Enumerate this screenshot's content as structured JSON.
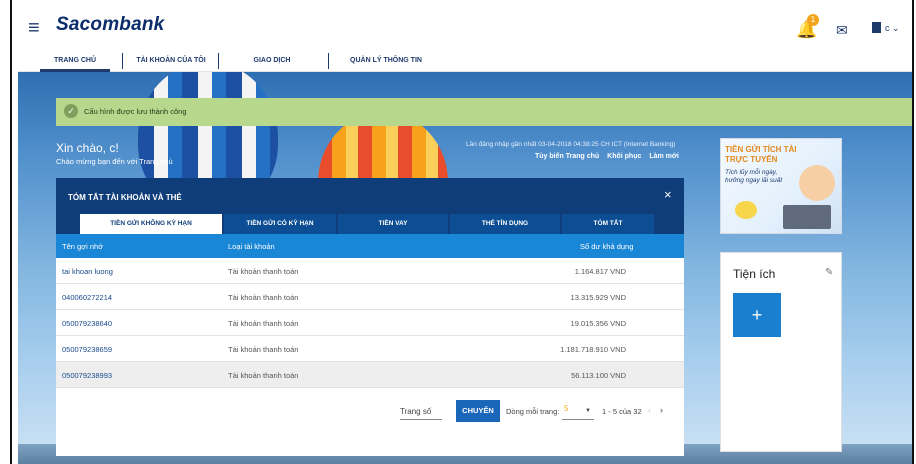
{
  "header": {
    "brand": "Sacombank",
    "notification_count": "1",
    "user_initial": "c"
  },
  "nav": {
    "tabs": [
      "TRANG CHỦ",
      "TÀI KHOẢN CỦA TÔI",
      "GIAO DỊCH",
      "QUẢN LÝ THÔNG TIN"
    ],
    "active": "TRANG CHỦ"
  },
  "banner": {
    "message": "Cấu hình được lưu thành công"
  },
  "greeting": {
    "title": "Xin chào, c!",
    "subtitle": "Chào mừng bạn đến với Trang chủ",
    "last_login": "Lần đăng nhập gần nhất 03-04-2018 04:38:25 CH ICT (Internet Banking)",
    "links": [
      "Tùy biến Trang chủ",
      "Khôi phục",
      "Làm mới"
    ]
  },
  "promo": {
    "title": "TIỀN GỬI TÍCH TÀI TRỰC TUYẾN",
    "subtitle": "Tích lũy mỗi ngày, hưởng ngay lãi suất"
  },
  "utility": {
    "title": "Tiện ích",
    "add_label": "+"
  },
  "summary": {
    "title": "TÓM TẮT TÀI KHOẢN VÀ THẺ",
    "close": "×",
    "tabs": [
      "TIỀN GỬI KHÔNG KỲ HẠN",
      "TIỀN GỬI CÓ KỲ HẠN",
      "TIỀN VAY",
      "THẺ TÍN DỤNG",
      "TÓM TẮT"
    ],
    "active_tab": 0,
    "columns": [
      "Tên gợi nhớ",
      "Loại tài khoản",
      "Số dư khả dụng"
    ],
    "rows": [
      {
        "name": "tai khoan luong",
        "type": "Tài khoản thanh toán",
        "balance": "1.164.817 VND"
      },
      {
        "name": "040060272214",
        "type": "Tài khoản thanh toán",
        "balance": "13.315.929 VND"
      },
      {
        "name": "050079238640",
        "type": "Tài khoản thanh toán",
        "balance": "19.015.356 VND"
      },
      {
        "name": "050079238659",
        "type": "Tài khoản thanh toán",
        "balance": "1.181.718.910 VND"
      },
      {
        "name": "050079238993",
        "type": "Tài khoản thanh toán",
        "balance": "56.113.100 VND"
      }
    ],
    "highlighted_row": 4
  },
  "pager": {
    "page_label": "Trang số",
    "go_button": "CHUYỂN",
    "rows_label": "Dòng mỗi trang:",
    "rows_value": "5",
    "range": "1 - 5 của 32"
  },
  "colors": {
    "brand_navy": "#0f3d79",
    "table_header": "#1a86d6",
    "success": "#b7d78c",
    "accent": "#f2a51c"
  }
}
